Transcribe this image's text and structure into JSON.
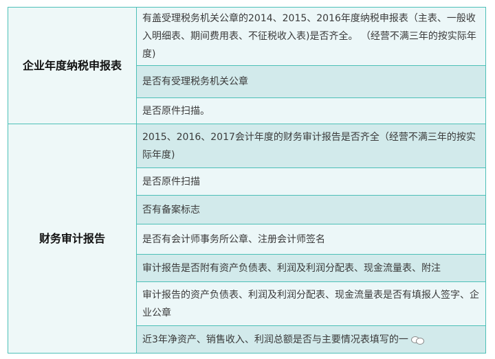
{
  "sections": [
    {
      "category": "企业年度纳税申报表",
      "items": [
        "有盖受理税务机关公章的2014、2015、2016年度纳税申报表（主表、一般收入明细表、期间费用表、不征税收入表)是否齐全。 （经营不满三年的按实际年度)",
        "是否有受理税务机关公章",
        "是否原件扫描。"
      ]
    },
    {
      "category": "财务审计报告",
      "items": [
        "2015、2016、2017会计年度的财务审计报告是否齐全（经营不满三年的按实际年度)",
        "是否原件扫描",
        "否有备案标志",
        "是否有会计师事务所公章、注册会计师签名",
        "审计报告是否附有资产负债表、利润及利润分配表、现金流量表、附注",
        "审计报告的资产负债表、利润及利润分配表、现金流量表是否有填报人签字、企业公章",
        "近3年净资产、销售收入、利润总额是否与主要情况表填写的一"
      ]
    }
  ]
}
